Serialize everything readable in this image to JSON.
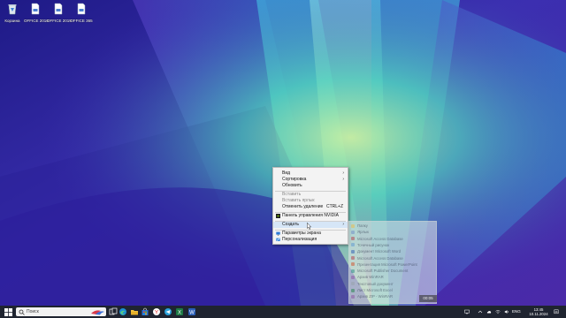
{
  "desktop": {
    "icons": [
      {
        "label": "Корзина",
        "icon": "recycle-bin-icon"
      },
      {
        "label": "OFFICE 2016",
        "icon": "document-icon"
      },
      {
        "label": "OFFICE 2019",
        "icon": "document-icon"
      },
      {
        "label": "OFFICE 365",
        "icon": "document-icon"
      }
    ]
  },
  "context_menu": {
    "items": [
      {
        "label": "Вид",
        "submenu": true
      },
      {
        "label": "Сортировка",
        "submenu": true
      },
      {
        "label": "Обновить"
      },
      {
        "label": "Вставить",
        "disabled": true
      },
      {
        "label": "Вставить ярлык",
        "disabled": true
      },
      {
        "label": "Отменить удаление",
        "shortcut": "CTRL+Z"
      },
      {
        "label": "Панель управления NVIDIA",
        "icon": "nvidia-icon"
      },
      {
        "label": "Создать",
        "submenu": true,
        "highlighted": true
      },
      {
        "label": "Параметры экрана",
        "icon": "display-icon"
      },
      {
        "label": "Персонализация",
        "icon": "personalize-icon"
      }
    ]
  },
  "create_submenu": {
    "items": [
      {
        "label": "Папку",
        "icon": "folder-icon"
      },
      {
        "label": "Ярлык",
        "icon": "shortcut-icon"
      },
      {
        "label": "Microsoft Access Database",
        "icon": "access-icon"
      },
      {
        "label": "Точечный рисунок",
        "icon": "bitmap-icon"
      },
      {
        "label": "Документ Microsoft Word",
        "icon": "word-icon"
      },
      {
        "label": "Microsoft Access Database",
        "icon": "access-icon"
      },
      {
        "label": "Презентация Microsoft PowerPoint",
        "icon": "powerpoint-icon"
      },
      {
        "label": "Microsoft Publisher Document",
        "icon": "publisher-icon"
      },
      {
        "label": "Архив WinRAR",
        "icon": "archive-icon"
      },
      {
        "label": "Текстовый документ",
        "icon": "text-icon"
      },
      {
        "label": "Лист Microsoft Excel",
        "icon": "excel-icon"
      },
      {
        "label": "Архив ZIP - WinRAR",
        "icon": "archive-icon"
      }
    ],
    "timer": "00:05"
  },
  "taskbar": {
    "search_placeholder": "Поиск",
    "clock_time": "13:45",
    "clock_date": "10.11.2024",
    "language": "ENG",
    "accent": "#1f2430"
  }
}
